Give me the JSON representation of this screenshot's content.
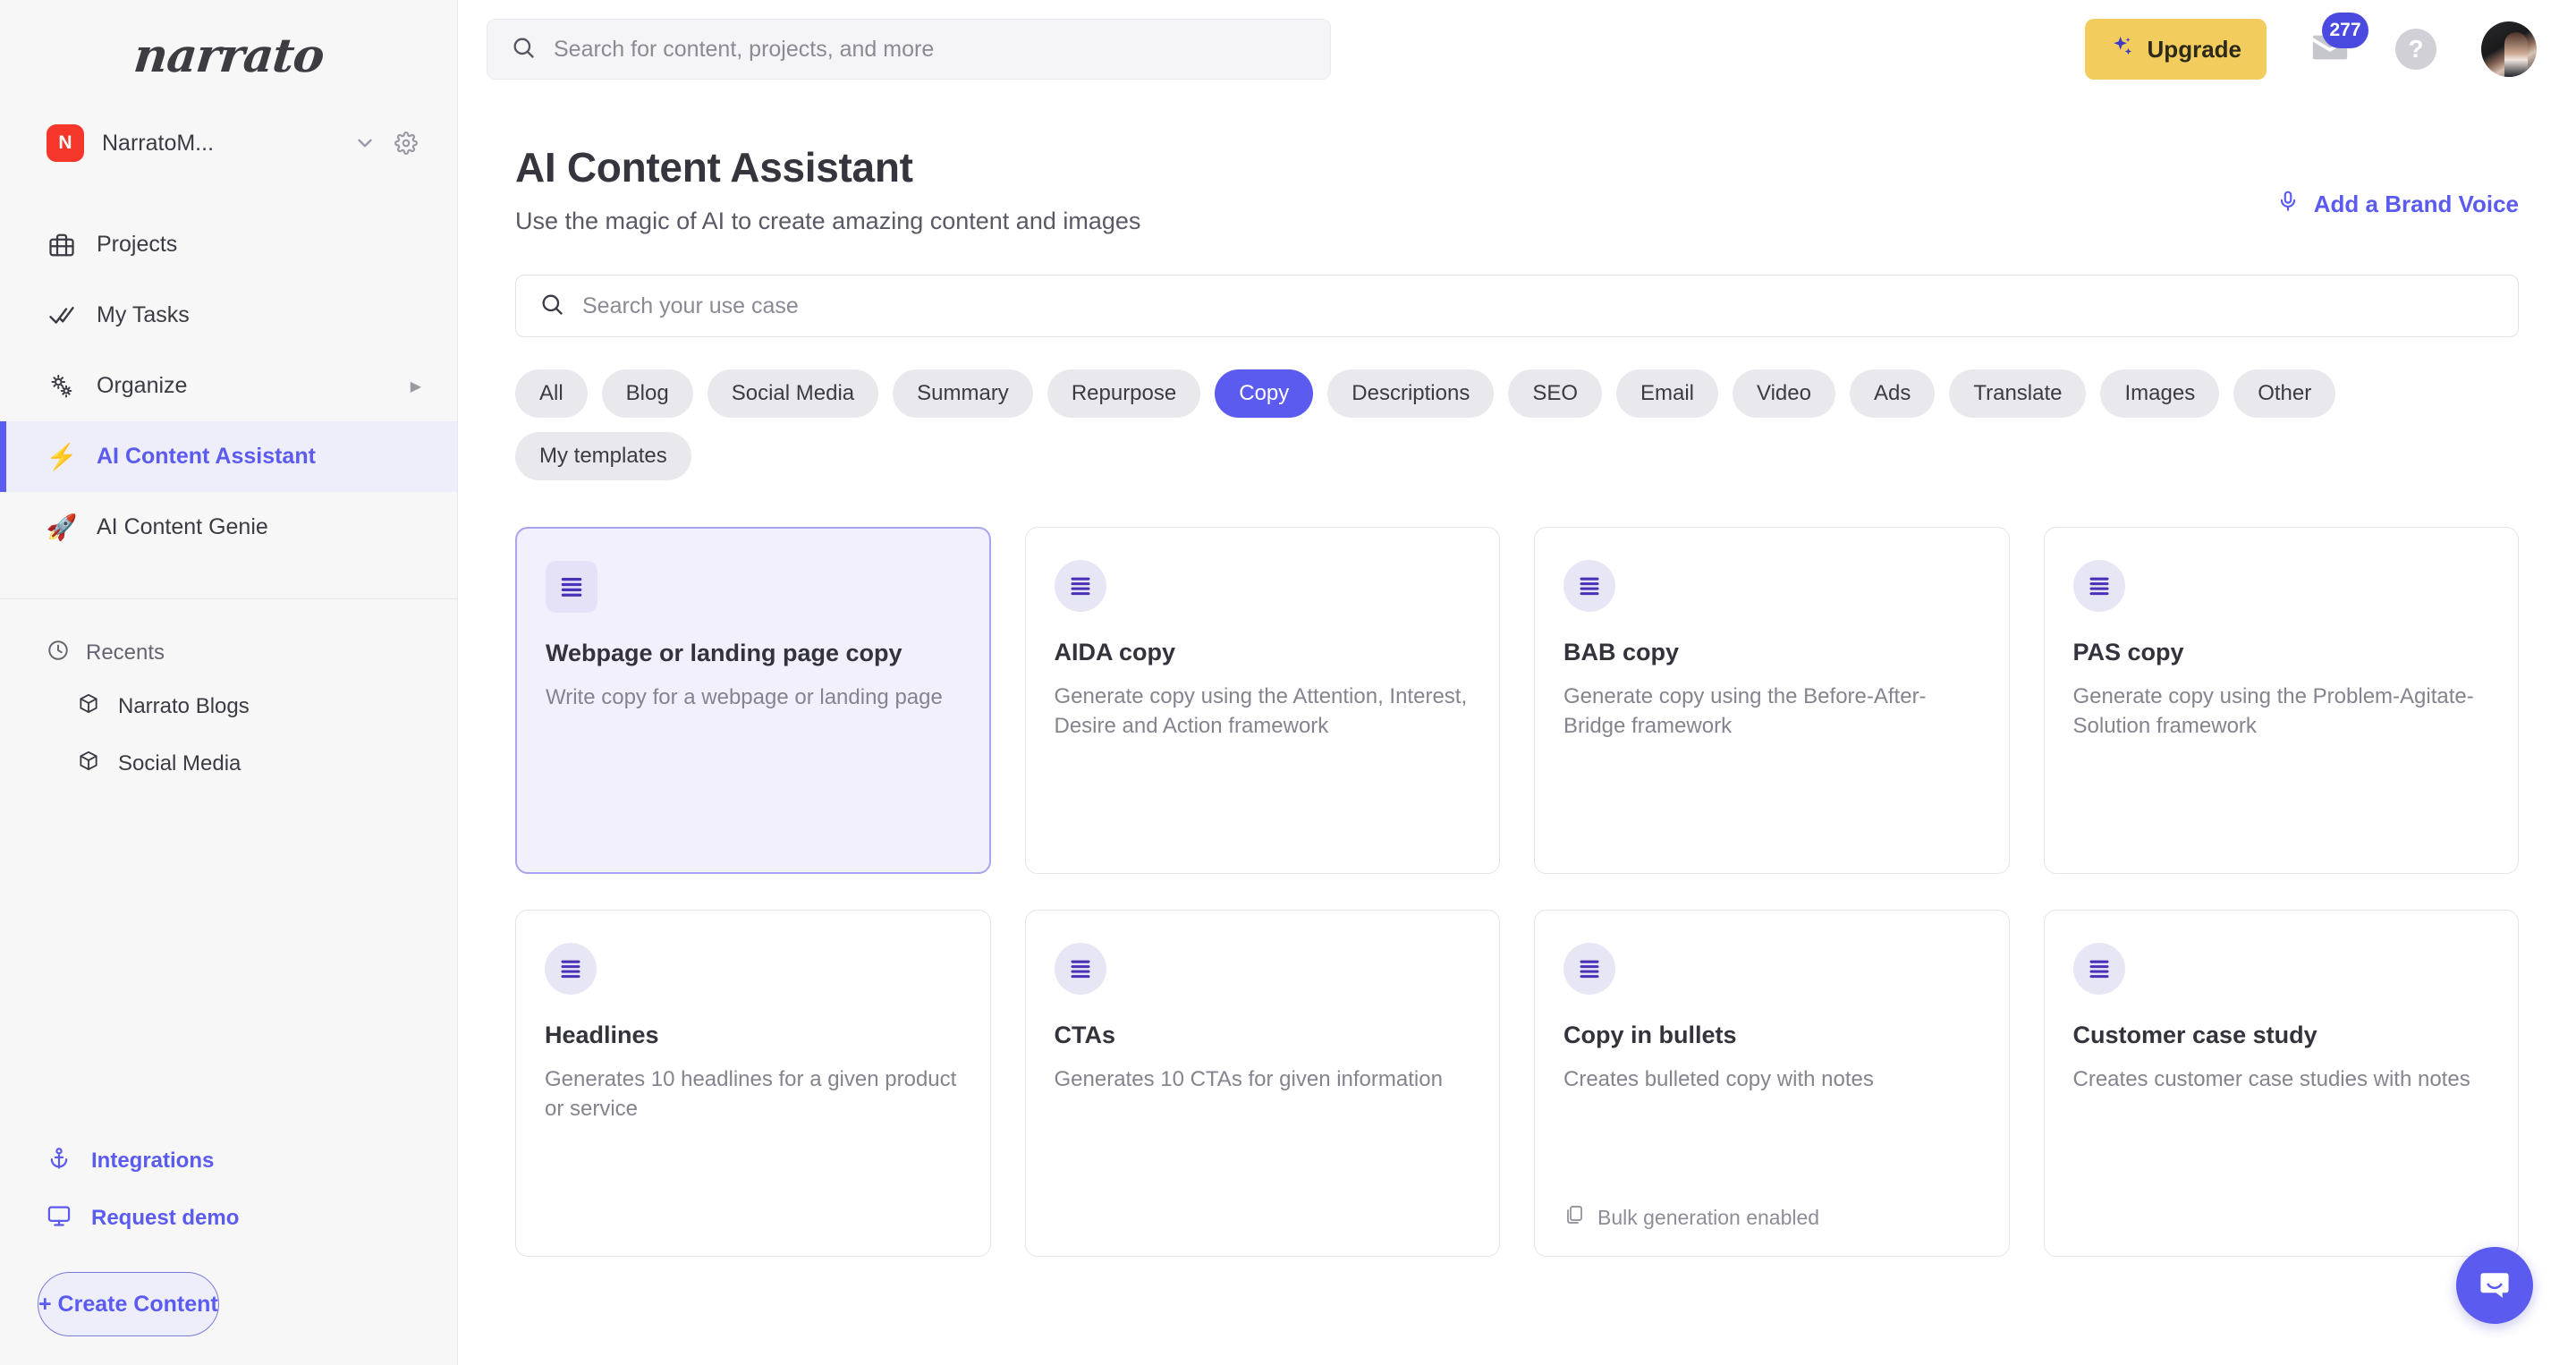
{
  "brand": {
    "logo_text": "narrato"
  },
  "workspace": {
    "initial": "N",
    "name": "NarratoM...",
    "chevron_icon": "chevron-down-icon",
    "gear_icon": "gear-icon"
  },
  "sidebar": {
    "items": [
      {
        "label": "Projects",
        "icon": "briefcase-icon",
        "active": false
      },
      {
        "label": "My Tasks",
        "icon": "double-check-icon",
        "active": false
      },
      {
        "label": "Organize",
        "icon": "gears-icon",
        "active": false,
        "caret": "▶"
      },
      {
        "label": "AI Content Assistant",
        "icon": "lightning-emoji",
        "emoji": "⚡",
        "active": true
      },
      {
        "label": "AI Content Genie",
        "icon": "rocket-emoji",
        "emoji": "🚀",
        "active": false
      }
    ],
    "recents_label": "Recents",
    "recents": [
      {
        "label": "Narrato Blogs",
        "icon": "cube-icon"
      },
      {
        "label": "Social Media",
        "icon": "cube-icon"
      }
    ],
    "bottom_links": [
      {
        "label": "Integrations",
        "icon": "anchor-icon"
      },
      {
        "label": "Request demo",
        "icon": "monitor-icon"
      }
    ],
    "create_button": "+ Create Content"
  },
  "topbar": {
    "search_placeholder": "Search for content, projects, and more",
    "search_value": "",
    "search_icon": "search-icon",
    "upgrade_label": "Upgrade",
    "upgrade_icon": "sparkle-icon",
    "mail_icon": "mail-icon",
    "mail_badge": "277",
    "help_icon": "help-circle-icon",
    "avatar": "user-avatar"
  },
  "page": {
    "title": "AI Content Assistant",
    "subtitle": "Use the magic of AI to create amazing content and images",
    "brand_voice_label": "Add a Brand Voice",
    "brand_voice_icon": "microphone-icon",
    "usecase_search_placeholder": "Search your use case",
    "usecase_search_value": "",
    "usecase_search_icon": "search-icon"
  },
  "filters": [
    {
      "label": "All",
      "active": false
    },
    {
      "label": "Blog",
      "active": false
    },
    {
      "label": "Social Media",
      "active": false
    },
    {
      "label": "Summary",
      "active": false
    },
    {
      "label": "Repurpose",
      "active": false
    },
    {
      "label": "Copy",
      "active": true
    },
    {
      "label": "Descriptions",
      "active": false
    },
    {
      "label": "SEO",
      "active": false
    },
    {
      "label": "Email",
      "active": false
    },
    {
      "label": "Video",
      "active": false
    },
    {
      "label": "Ads",
      "active": false
    },
    {
      "label": "Translate",
      "active": false
    },
    {
      "label": "Images",
      "active": false
    },
    {
      "label": "Other",
      "active": false
    },
    {
      "label": "My templates",
      "active": false
    }
  ],
  "cards": [
    {
      "title": "Webpage or landing page copy",
      "desc": "Write copy for a webpage or landing page",
      "icon": "list-lines-icon",
      "selected": true,
      "footer": ""
    },
    {
      "title": "AIDA copy",
      "desc": "Generate copy using the Attention, Interest, Desire and Action framework",
      "icon": "list-lines-icon",
      "selected": false,
      "footer": ""
    },
    {
      "title": "BAB copy",
      "desc": "Generate copy using the Before-After-Bridge framework",
      "icon": "list-lines-icon",
      "selected": false,
      "footer": ""
    },
    {
      "title": "PAS copy",
      "desc": "Generate copy using the Problem-Agitate-Solution framework",
      "icon": "list-lines-icon",
      "selected": false,
      "footer": ""
    },
    {
      "title": "Headlines",
      "desc": "Generates 10 headlines for a given product or service",
      "icon": "list-lines-icon",
      "selected": false,
      "footer": ""
    },
    {
      "title": "CTAs",
      "desc": "Generates 10 CTAs for given information",
      "icon": "list-lines-icon",
      "selected": false,
      "footer": ""
    },
    {
      "title": "Copy in bullets",
      "desc": "Creates bulleted copy with notes",
      "icon": "list-lines-icon",
      "selected": false,
      "footer": "Bulk generation enabled",
      "footer_icon": "copy-icon"
    },
    {
      "title": "Customer case study",
      "desc": "Creates customer case studies with notes",
      "icon": "list-lines-icon",
      "selected": false,
      "footer": ""
    }
  ],
  "chat": {
    "icon": "chat-bubble-icon"
  },
  "colors": {
    "accent": "#5b5bef",
    "upgrade": "#f2cc5c",
    "workspace_badge": "#f5372b",
    "badge": "#4a4ae0"
  }
}
